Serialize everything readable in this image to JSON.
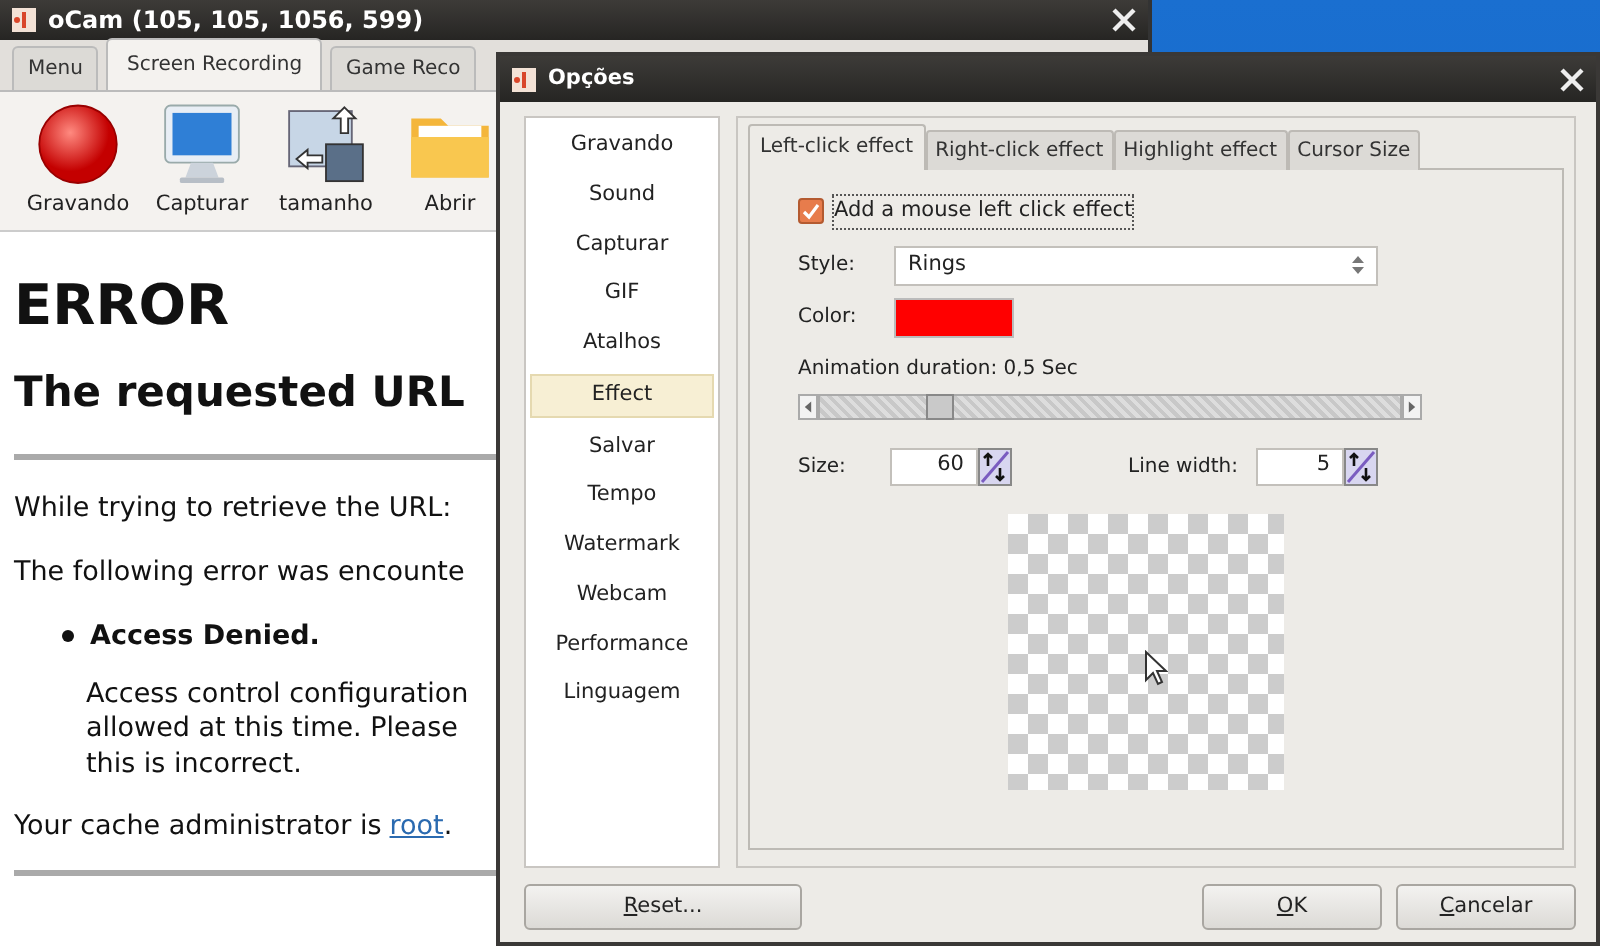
{
  "main_window": {
    "title": "oCam (105, 105, 1056, 599)",
    "tabs": [
      {
        "label": "Menu",
        "selected": false
      },
      {
        "label": "Screen Recording",
        "selected": true
      },
      {
        "label": "Game Reco",
        "selected": false
      }
    ],
    "toolbar": [
      {
        "label": "Gravando",
        "kind": "record"
      },
      {
        "label": "Capturar",
        "kind": "monitor"
      },
      {
        "label": "tamanho",
        "kind": "resize"
      },
      {
        "label": "Abrir",
        "kind": "folder"
      }
    ]
  },
  "browser": {
    "heading": "ERROR",
    "subheading": "The requested URL",
    "paragraphs": [
      "While trying to retrieve the URL:",
      "The following error was encounte"
    ],
    "bullet": {
      "title": "Access Denied.",
      "lines": [
        "Access control configuration",
        "allowed at this time. Please",
        "this is incorrect."
      ]
    },
    "admin": {
      "text": "Your cache administrator is",
      "link": "root",
      "after": "."
    }
  },
  "dialog": {
    "title": "Opções",
    "categories": [
      {
        "label": "Gravando",
        "selected": false
      },
      {
        "label": "Sound",
        "selected": false
      },
      {
        "label": "Capturar",
        "selected": false
      },
      {
        "label": "GIF",
        "selected": false
      },
      {
        "label": "Atalhos",
        "selected": false
      },
      {
        "label": "Effect",
        "selected": true
      },
      {
        "label": "Salvar",
        "selected": false
      },
      {
        "label": "Tempo",
        "selected": false
      },
      {
        "label": "Watermark",
        "selected": false
      },
      {
        "label": "Webcam",
        "selected": false
      },
      {
        "label": "Performance",
        "selected": false
      },
      {
        "label": "Linguagem",
        "selected": false
      }
    ],
    "tabs": [
      {
        "label": "Left-click effect",
        "selected": true
      },
      {
        "label": "Right-click effect",
        "selected": false
      },
      {
        "label": "Highlight effect",
        "selected": false
      },
      {
        "label": "Cursor Size",
        "selected": false
      }
    ],
    "checkbox": {
      "label": "Add a mouse left click effect",
      "checked": true
    },
    "style": {
      "label": "Style:",
      "value": "Rings"
    },
    "color": {
      "label": "Color:",
      "color": "#ff0000"
    },
    "animation": {
      "label": "Animation duration: 0,5 Sec",
      "level": 0.19
    },
    "size": {
      "label": "Size:",
      "value": "60"
    },
    "line_width": {
      "label": "Line width:",
      "value": "5"
    },
    "buttons": [
      {
        "label": "Reset...",
        "kind": "reset",
        "mnemonic": true
      },
      {
        "label": "OK",
        "kind": "ok",
        "mnemonic": true
      },
      {
        "label": "Cancelar",
        "kind": "cancel",
        "mnemonic": true
      }
    ]
  }
}
